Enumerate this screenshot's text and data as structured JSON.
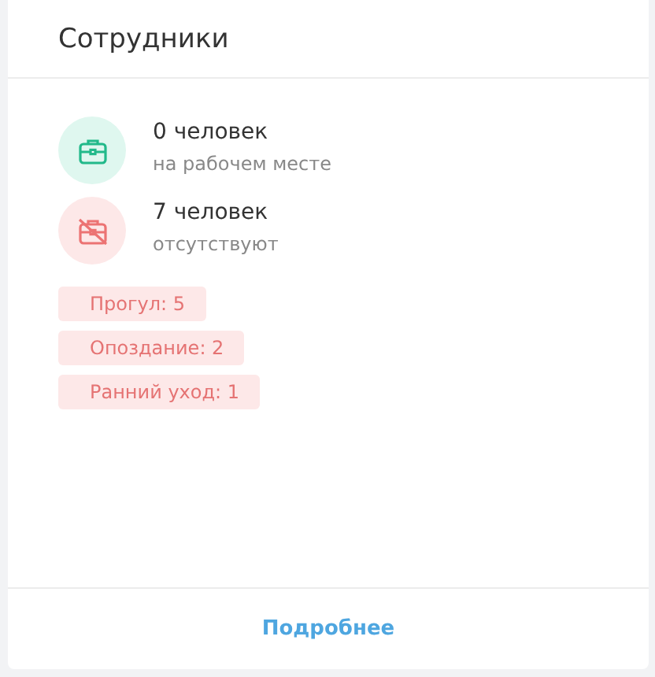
{
  "card": {
    "title": "Сотрудники",
    "stats": [
      {
        "kind": "present",
        "count": "0 человек",
        "caption": "на рабочем месте"
      },
      {
        "kind": "absent",
        "count": "7 человек",
        "caption": "отсутствуют"
      }
    ],
    "tags": [
      "Прогул: 5",
      "Опоздание: 2",
      "Ранний уход: 1"
    ],
    "link": "Подробнее"
  }
}
